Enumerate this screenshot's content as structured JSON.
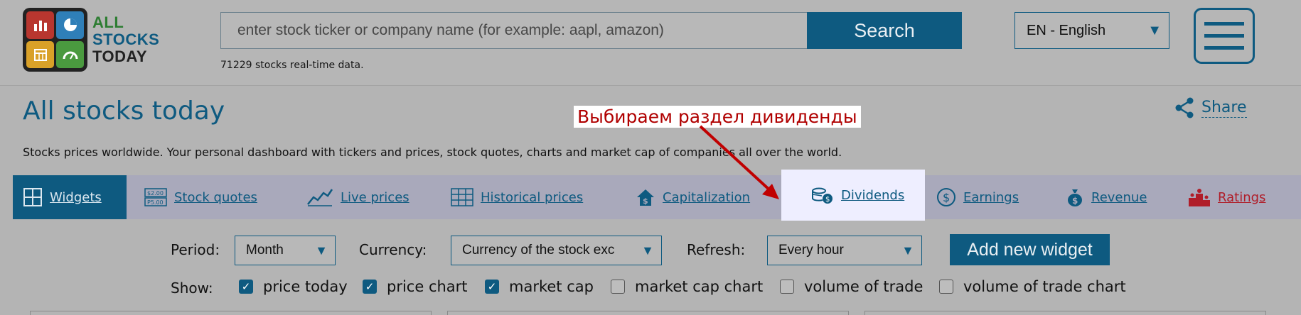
{
  "logo": {
    "line1": "ALL",
    "line2": "STOCKS",
    "line3": "TODAY",
    "colors": [
      "#b8362f",
      "#2f7fb8",
      "#d9a128",
      "#4a9a3f"
    ],
    "icon_names": [
      "bar-chart-icon",
      "pie-chart-icon",
      "calendar-icon",
      "gauge-icon"
    ]
  },
  "search": {
    "placeholder": "enter stock ticker or company name (for example: aapl, amazon)",
    "button": "Search",
    "count_text": "71229 stocks real-time data."
  },
  "language": {
    "selected": "EN - English"
  },
  "page": {
    "title": "All stocks today",
    "share": "Share",
    "subtitle": "Stocks prices worldwide. Your personal dashboard with tickers and prices, stock quotes, charts and market cap of companies all over the world."
  },
  "annotation": {
    "text": "Выбираем раздел дивиденды",
    "color": "#b00000"
  },
  "tabs": [
    {
      "label": "Widgets",
      "icon": "grid-icon",
      "active": true
    },
    {
      "label": "Stock quotes",
      "icon": "price-tag-icon"
    },
    {
      "label": "Live prices",
      "icon": "line-chart-icon"
    },
    {
      "label": "Historical prices",
      "icon": "table-icon"
    },
    {
      "label": "Capitalization",
      "icon": "house-dollar-icon"
    },
    {
      "label": "Dividends",
      "icon": "coins-icon",
      "highlighted": true
    },
    {
      "label": "Earnings",
      "icon": "dollar-circle-icon"
    },
    {
      "label": "Revenue",
      "icon": "money-bag-icon"
    },
    {
      "label": "Ratings",
      "icon": "podium-icon",
      "color": "#b01d29"
    }
  ],
  "controls": {
    "period_label": "Period:",
    "period_value": "Month",
    "currency_label": "Currency:",
    "currency_value": "Currency of the stock exc",
    "refresh_label": "Refresh:",
    "refresh_value": "Every hour",
    "add_button": "Add new widget",
    "show_label": "Show:",
    "show_options": [
      {
        "label": "price today",
        "checked": true
      },
      {
        "label": "price chart",
        "checked": true
      },
      {
        "label": "market cap",
        "checked": true
      },
      {
        "label": "market cap chart",
        "checked": false
      },
      {
        "label": "volume of trade",
        "checked": false
      },
      {
        "label": "volume of trade chart",
        "checked": false
      }
    ]
  }
}
